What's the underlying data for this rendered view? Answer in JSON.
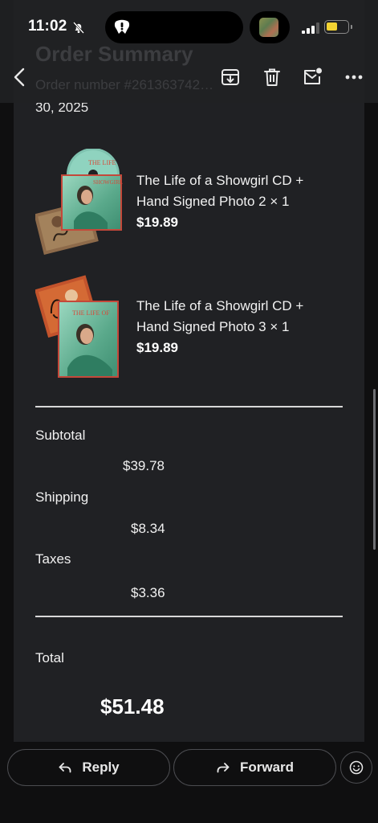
{
  "status_bar": {
    "time": "11:02",
    "icons": [
      "bell-slash-icon",
      "app-activity-icon",
      "now-playing-artwork",
      "cellular-signal-icon",
      "battery-icon"
    ],
    "battery_color": "#f3d332"
  },
  "header": {
    "ghost_title": "Order Summary",
    "ghost_subtitle": "Order number #261363742…",
    "date_tail": "30, 2025",
    "actions": [
      "back-icon",
      "archive-icon",
      "delete-icon",
      "mark-unread-icon",
      "more-icon"
    ]
  },
  "items": [
    {
      "name": "The Life of a Showgirl CD + Hand Signed Photo 2 × 1",
      "price": "$19.89"
    },
    {
      "name": "The Life of a Showgirl CD + Hand Signed Photo 3 × 1",
      "price": "$19.89"
    }
  ],
  "summary": {
    "subtotal_label": "Subtotal",
    "subtotal_value": "$39.78",
    "shipping_label": "Shipping",
    "shipping_value": "$8.34",
    "taxes_label": "Taxes",
    "taxes_value": "$3.36",
    "total_label": "Total",
    "total_value": "$51.48"
  },
  "bottom_actions": {
    "reply_label": "Reply",
    "forward_label": "Forward",
    "emoji_icon": "smiley-icon"
  },
  "colors": {
    "background": "#0f0f10",
    "card": "#202124",
    "text": "#ffffff",
    "divider": "#d8d8d8",
    "outline": "#4b4c50"
  }
}
